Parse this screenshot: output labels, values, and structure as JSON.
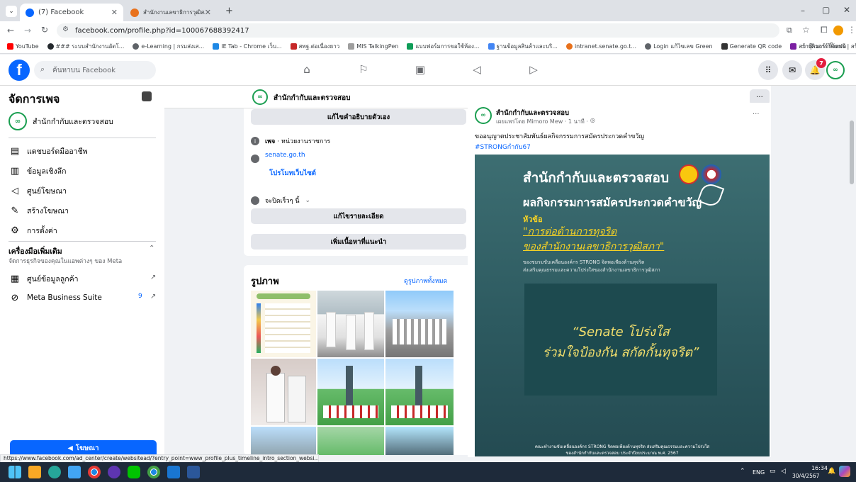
{
  "browser": {
    "tabs": [
      {
        "label": "(7) Facebook",
        "active": true
      },
      {
        "label": "สำนักงานเลขาธิการวุฒิสภา",
        "active": false
      }
    ],
    "new_tab": "+",
    "url": "facebook.com/profile.php?id=100067688392417",
    "bookmarks": [
      "YouTube",
      "### ระบบสำนักงานอัตโ...",
      "e-Learning | กรมส่งเส...",
      "IE Tab - Chrome เว็บ...",
      "สพฐ.ต่อเนื่องยาว",
      "MIS TalkingPen",
      "แบบฟอร์มการขอใช้ห้อง...",
      "ฐานข้อมูลสินค้าและบริ...",
      "intranet.senate.go.t...",
      "Login แก้ไขเลข Green",
      "Generate QR code",
      "สร้างคิวอาร์โค้ดฟรี | สร้าง...",
      "บุ๊กมาร์กทั้งหมด"
    ]
  },
  "fb": {
    "logo": "f",
    "search_placeholder": "ค้นหาบน Facebook",
    "notification_count": "7"
  },
  "sidebar": {
    "title": "จัดการเพจ",
    "page_name": "สำนักกำกับและตรวจสอบ",
    "items": [
      {
        "label": "แดชบอร์ดมืออาชีพ",
        "icon": "dashboard-icon"
      },
      {
        "label": "ข้อมูลเชิงลึก",
        "icon": "insights-icon"
      },
      {
        "label": "ศูนย์โฆษณา",
        "icon": "megaphone-icon"
      },
      {
        "label": "สร้างโฆษณา",
        "icon": "edit-icon"
      },
      {
        "label": "การตั้งค่า",
        "icon": "gear-icon"
      }
    ],
    "more_tools_title": "เครื่องมือเพิ่มเติม",
    "more_tools_sub": "จัดการธุรกิจของคุณในแอพต่างๆ ของ Meta",
    "tools": [
      {
        "label": "ศูนย์ข้อมูลลูกค้า"
      },
      {
        "label": "Meta Business Suite",
        "badge": "9"
      }
    ],
    "advertise_button": "โฆษณา"
  },
  "page_header": {
    "name": "สำนักกำกับและตรวจสอบ",
    "more": "···"
  },
  "intro": {
    "edit_bio": "แก้ไขคำอธิบายตัวเอง",
    "category_label": "เพจ",
    "category": "หน่วยงานราชการ",
    "website": "senate.go.th",
    "promote_website": "โปรโมทเว็บไซต์",
    "hours": "จะปิดเร็วๆ นี้",
    "edit_details": "แก้ไขรายละเอียด",
    "add_featured": "เพิ่มเนื้อหาที่แนะนำ"
  },
  "photos": {
    "title": "รูปภาพ",
    "see_all": "ดูรูปภาพทั้งหมด"
  },
  "post": {
    "author": "สำนักกำกับและตรวจสอบ",
    "meta": "เผยแพร่โดย Mimoro Mew · 1 นาที ·",
    "text": "ขออนุญาตประชาสัมพันธ์ผลกิจกรรมการสมัครประกวดคำขวัญ",
    "hashtag": "#STRONGกำกับ67",
    "more": "···",
    "image": {
      "org": "สำนักกำกับและตรวจสอบ",
      "headline": "ผลกิจกรรมการสมัครประกวดคำขวัญ",
      "topic_label": "หัวข้อ",
      "topic_line1": "\"การต่อต้านการทุจริต",
      "topic_line2": "ของสำนักงานเลขาธิการวุฒิสภา\"",
      "sub1": "ของชมรมขับเคลื่อนองค์กร STRONG จิตพอเพียงต้านทุจริต",
      "sub2": "ส่งเสริมคุณธรรมและความโปร่งใสของสำนักงานเลขาธิการวุฒิสภา",
      "quote_line1": "“Senate โปร่งใส",
      "quote_line2": "ร่วมใจป้องกัน สกัดกั้นทุจริต”",
      "footer1": "คณะทำงานขับเคลื่อนองค์กร STRONG จิตพอเพียงต้านทุจริต ส่งเสริมคุณธรรมและความโปร่งใส",
      "footer2": "ของสำนักกำกับและตรวจสอบ ประจำปีงบประมาณ พ.ศ. 2567"
    }
  },
  "status_url": "https://www.facebook.com/ad_center/create/websitead/?entry_point=www_profile_plus_timeline_intro_section_websi...",
  "taskbar": {
    "lang": "ENG",
    "time": "16:34",
    "date": "30/4/2567"
  },
  "colors": {
    "fb_blue": "#0866ff",
    "teal": "#2d5a60",
    "logo_green": "#1a9e50"
  }
}
